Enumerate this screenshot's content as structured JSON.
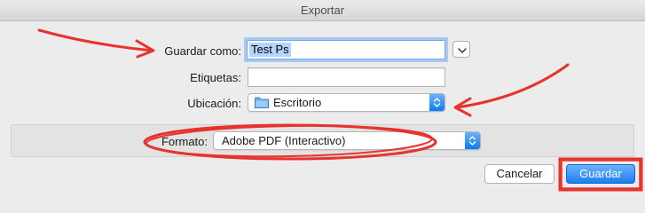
{
  "window": {
    "title": "Exportar"
  },
  "form": {
    "save_as_label": "Guardar como:",
    "save_as_value": "Test Ps",
    "tags_label": "Etiquetas:",
    "tags_value": "",
    "location_label": "Ubicación:",
    "location_value": "Escritorio",
    "format_label": "Formato:",
    "format_value": "Adobe PDF (Interactivo)"
  },
  "buttons": {
    "cancel_label": "Cancelar",
    "save_label": "Guardar"
  },
  "icons": {
    "expand": "chevron-down-icon",
    "location": "folder-icon",
    "popup_arrows": "up-down-arrows-icon"
  },
  "colors": {
    "accent": "#1a7ff2",
    "selection": "#b4d5fe",
    "annotation": "#e8322d"
  }
}
